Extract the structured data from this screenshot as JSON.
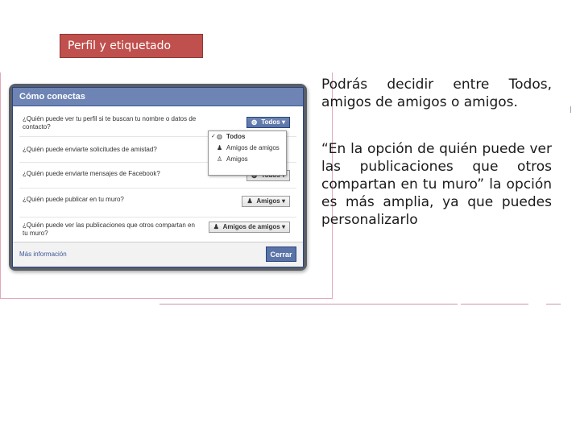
{
  "slide_title": "Perfil y etiquetado",
  "dialog": {
    "header": "Cómo conectas",
    "rows": [
      {
        "question": "¿Quién puede ver tu perfil si te buscan tu nombre o datos de contacto?",
        "value": "Todos",
        "icon": "globe-icon"
      },
      {
        "question": "¿Quién puede enviarte solicitudes de amistad?",
        "value": "",
        "icon": ""
      },
      {
        "question": "¿Quién puede enviarte mensajes de Facebook?",
        "value": "Todos",
        "icon": "globe-icon"
      },
      {
        "question": "¿Quién puede publicar en tu muro?",
        "value": "Amigos",
        "icon": "people-icon"
      },
      {
        "question": "¿Quién puede ver las publicaciones que otros compartan en tu muro?",
        "value": "Amigos de amigos",
        "icon": "people-icon"
      }
    ],
    "dropdown_options": [
      "Todos",
      "Amigos de amigos",
      "Amigos"
    ],
    "more_info": "Más información",
    "close_label": "Cerrar"
  },
  "text": {
    "para1": "Podrás decidir entre Todos, amigos de amigos o amigos.",
    "para2": "“En la opción de quién puede ver las publicaciones que otros compartan en tu muro” la opción es más amplia, ya que puedes personalizarlo"
  },
  "colors": {
    "title_bg": "#c0504d",
    "fb_header": "#6d84b4",
    "fb_button": "#5b74a8",
    "frame": "#e3a9b8"
  }
}
